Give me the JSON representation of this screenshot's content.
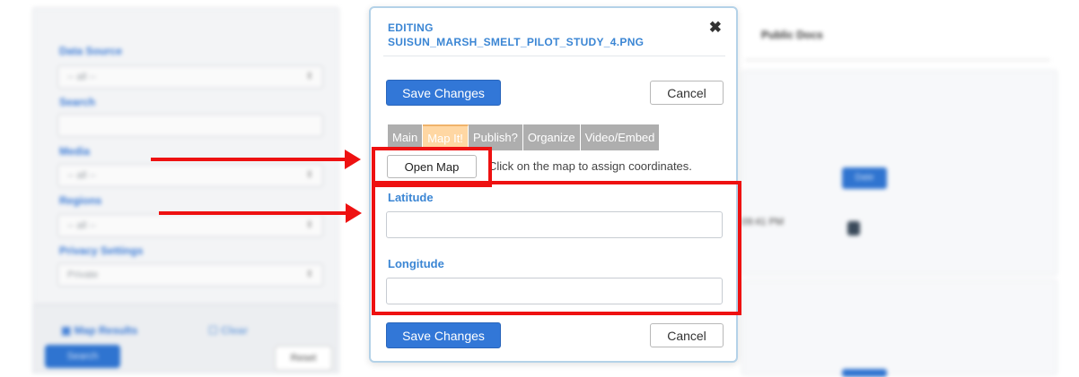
{
  "background": {
    "filters": {
      "data_source_label": "Data Source",
      "data_source_value": "-- all --",
      "search_label": "Search",
      "media_label": "Media",
      "media_value": "-- all --",
      "regions_label": "Regions",
      "regions_value": "-- all --",
      "privacy_label": "Privacy Settings",
      "privacy_value": "Private"
    },
    "map_results_label": "Map Results",
    "clear_label": "Clear",
    "search_button": "Search",
    "reset_button": "Reset",
    "column_header": "Public Docs",
    "timestamp_fragment": "09:41 PM",
    "chip_label": "Date"
  },
  "modal": {
    "title_prefix": "EDITING",
    "filename": "SUISUN_MARSH_SMELT_PILOT_STUDY_4.PNG",
    "close_glyph": "✖",
    "save_label": "Save Changes",
    "cancel_label": "Cancel",
    "tabs": [
      {
        "label": "Main",
        "active": false
      },
      {
        "label": "Map It!",
        "active": true
      },
      {
        "label": "Publish?",
        "active": false
      },
      {
        "label": "Organize",
        "active": false
      },
      {
        "label": "Video/Embed",
        "active": false
      }
    ],
    "open_map_label": "Open Map",
    "map_hint": "Click on the map to assign coordinates.",
    "latitude_label": "Latitude",
    "latitude_value": "",
    "longitude_label": "Longitude",
    "longitude_value": ""
  },
  "annotations": {
    "color": "#ee1111",
    "accent": "#3277d7"
  }
}
